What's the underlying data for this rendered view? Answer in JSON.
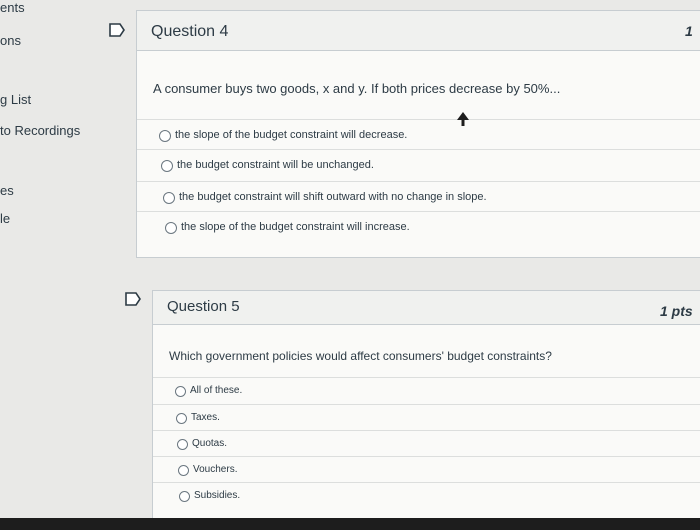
{
  "sidebar": {
    "items": [
      "ents",
      "ons",
      "g List",
      "to Recordings",
      "es",
      "le"
    ]
  },
  "question4": {
    "title": "Question 4",
    "points": "1",
    "text": "A consumer buys two goods, x and y. If both prices decrease by 50%...",
    "answers": [
      "the slope of the budget constraint will decrease.",
      "the budget constraint will be unchanged.",
      "the budget constraint will shift outward with no change in slope.",
      "the slope of the budget constraint will increase."
    ]
  },
  "question5": {
    "title": "Question 5",
    "points": "1 pts",
    "text": "Which government policies would affect consumers' budget constraints?",
    "answers": [
      "All of these.",
      "Taxes.",
      "Quotas.",
      "Vouchers.",
      "Subsidies."
    ]
  },
  "icons": {
    "flag": "flag-icon",
    "radio": "radio-button"
  }
}
